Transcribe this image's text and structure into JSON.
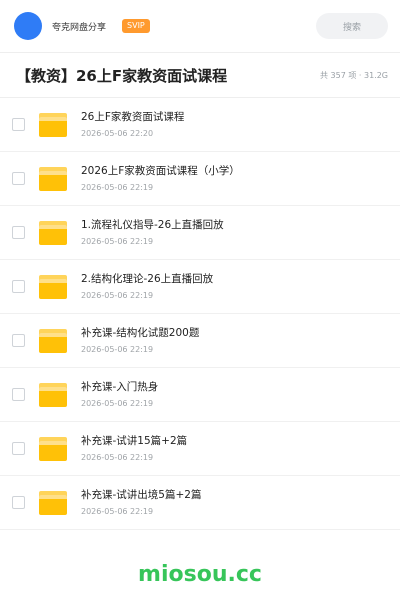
{
  "header": {
    "user_name": "夸克网盘分享",
    "badge": "SVIP",
    "search_label": "搜索"
  },
  "share": {
    "title": "【教资】26上F家教资面试课程",
    "meta": "共 357 项 · 31.2G"
  },
  "files": [
    {
      "name": "26上F家教资面试课程",
      "date": "2026-05-06 22:20",
      "icon": "folder-icon"
    },
    {
      "name": "2026上F家教资面试课程（小学）",
      "date": "2026-05-06 22:19",
      "icon": "folder-icon"
    },
    {
      "name": "1.流程礼仪指导-26上直播回放",
      "date": "2026-05-06 22:19",
      "icon": "folder-icon"
    },
    {
      "name": "2.结构化理论-26上直播回放",
      "date": "2026-05-06 22:19",
      "icon": "folder-icon"
    },
    {
      "name": "补充课-结构化试题200题",
      "date": "2026-05-06 22:19",
      "icon": "folder-icon"
    },
    {
      "name": "补充课-入门热身",
      "date": "2026-05-06 22:19",
      "icon": "folder-icon"
    },
    {
      "name": "补充课-试讲15篇+2篇",
      "date": "2026-05-06 22:19",
      "icon": "folder-icon"
    },
    {
      "name": "补充课-试讲出境5篇+2篇",
      "date": "2026-05-06 22:19",
      "icon": "folder-icon"
    }
  ],
  "watermark": "miosou.cc",
  "colors": {
    "avatar": "#2f7cf6",
    "badge": "#ff9a2e",
    "folder": "#ffc107",
    "watermark": "#37c55a"
  }
}
